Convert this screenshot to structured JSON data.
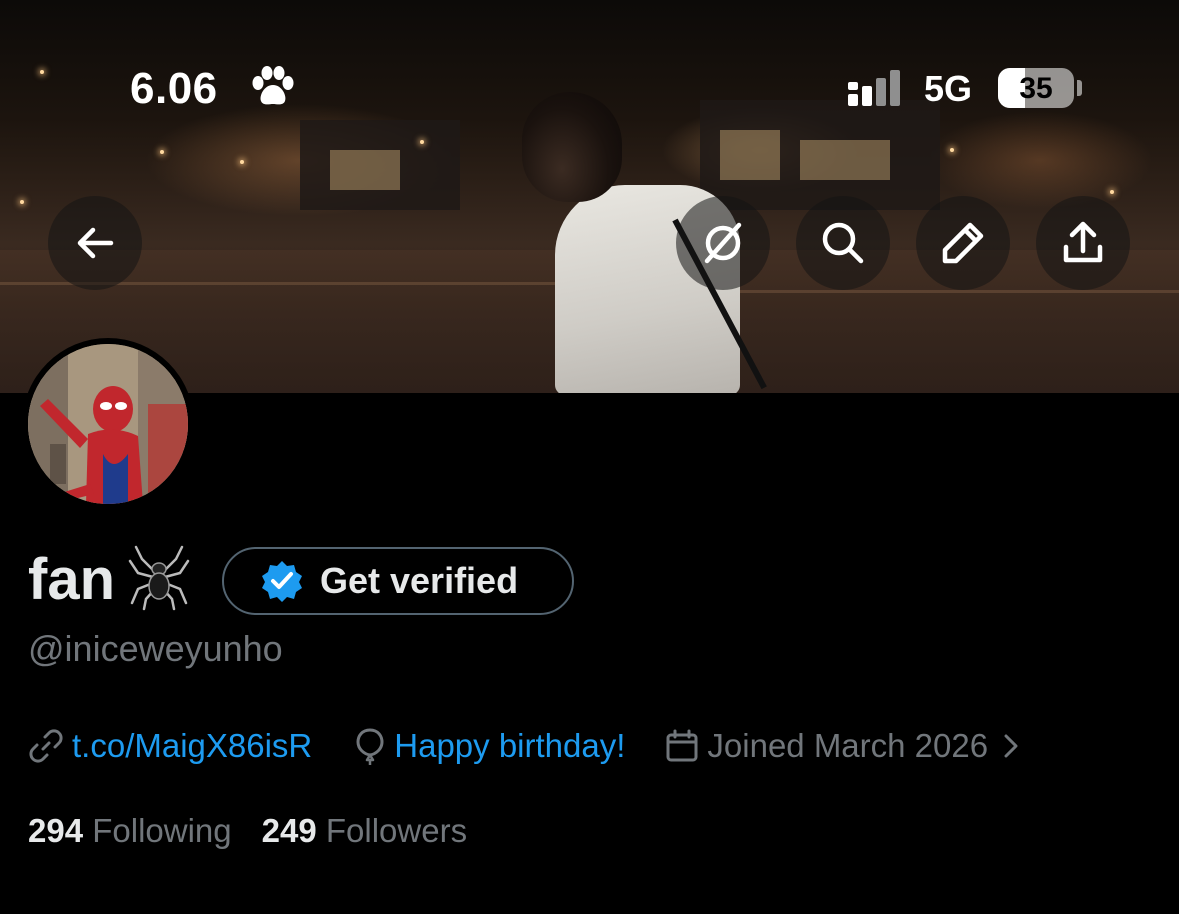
{
  "status_bar": {
    "time": "6.06",
    "time_icon": "paw-icon",
    "network": "5G",
    "battery_percent": "35",
    "battery_level": 0.35
  },
  "banner": {
    "description_icon": "banner-photo"
  },
  "nav": {
    "back_icon": "arrow-left-icon",
    "grok_icon": "slash-circle-icon",
    "search_icon": "search-icon",
    "edit_icon": "pencil-icon",
    "share_icon": "share-icon"
  },
  "profile": {
    "display_name": "fan",
    "name_emoji": "spider-icon",
    "get_verified_label": "Get verified",
    "handle": "@iniceweyunho",
    "website": "t.co/MaigX86isR",
    "birthday": "Happy birthday!",
    "joined": "Joined March 2026",
    "following_count": "294",
    "following_label": "Following",
    "followers_count": "249",
    "followers_label": "Followers"
  },
  "colors": {
    "background": "#000000",
    "accent": "#1d9bf0",
    "secondary_text": "#71767b",
    "primary_text": "#e7e9ea"
  }
}
